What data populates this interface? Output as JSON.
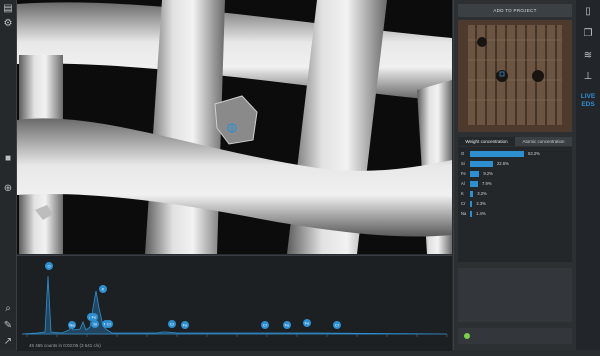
{
  "right_panel": {
    "add_button": "ADD TO PROJECT",
    "tabs": [
      "Weight concentration",
      "Atomic concentration"
    ],
    "elements": [
      {
        "symbol": "O",
        "value": "53.2%",
        "fraction": 0.532
      },
      {
        "symbol": "Si",
        "value": "22.6%",
        "fraction": 0.226
      },
      {
        "symbol": "Fe",
        "value": "9.2%",
        "fraction": 0.092
      },
      {
        "symbol": "Al",
        "value": "7.9%",
        "fraction": 0.079
      },
      {
        "symbol": "K",
        "value": "3.2%",
        "fraction": 0.032
      },
      {
        "symbol": "Cr",
        "value": "2.3%",
        "fraction": 0.023
      },
      {
        "symbol": "Na",
        "value": "1.4%",
        "fraction": 0.014
      }
    ]
  },
  "icon_bar": {
    "live_line1": "LIVE",
    "live_line2": "EDS"
  },
  "spectrum": {
    "status": "45 465 counts in 0:02:05 (3 641 c/s)",
    "peaks": [
      "O",
      "Na",
      "Al",
      "Si",
      "Fe",
      "K",
      "Cr",
      "Fe",
      "Cr",
      "Fe",
      "Fe",
      "Cr",
      "Fe",
      "Cr"
    ]
  },
  "colors": {
    "accent": "#2e8fd0",
    "status_ok": "#79d14b"
  }
}
